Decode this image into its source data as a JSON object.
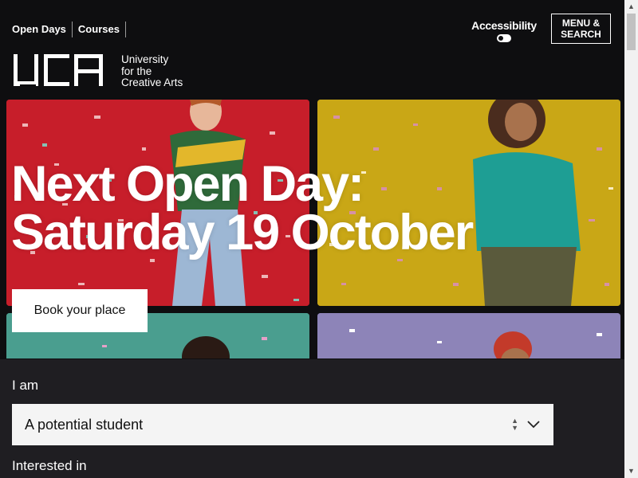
{
  "header": {
    "nav": [
      "Open Days",
      "Courses"
    ],
    "accessibility_label": "Accessibility",
    "menu_label_line1": "MENU &",
    "menu_label_line2": "SEARCH",
    "logo": {
      "mark": "UCA",
      "line1": "University",
      "line2": "for the",
      "line3": "Creative Arts"
    }
  },
  "hero": {
    "title_line1": "Next Open Day:",
    "title_line2": "Saturday 19 October",
    "cta_label": "Book your place"
  },
  "form": {
    "iam_label": "I am",
    "iam_value": "A potential student",
    "interested_label": "Interested in"
  },
  "colors": {
    "background": "#0e0e10",
    "panel": "#1f1e22",
    "tile_red": "#c71e2a",
    "tile_yellow": "#c9a716",
    "tile_teal": "#4a9e8f",
    "tile_lilac": "#8d84b8"
  }
}
